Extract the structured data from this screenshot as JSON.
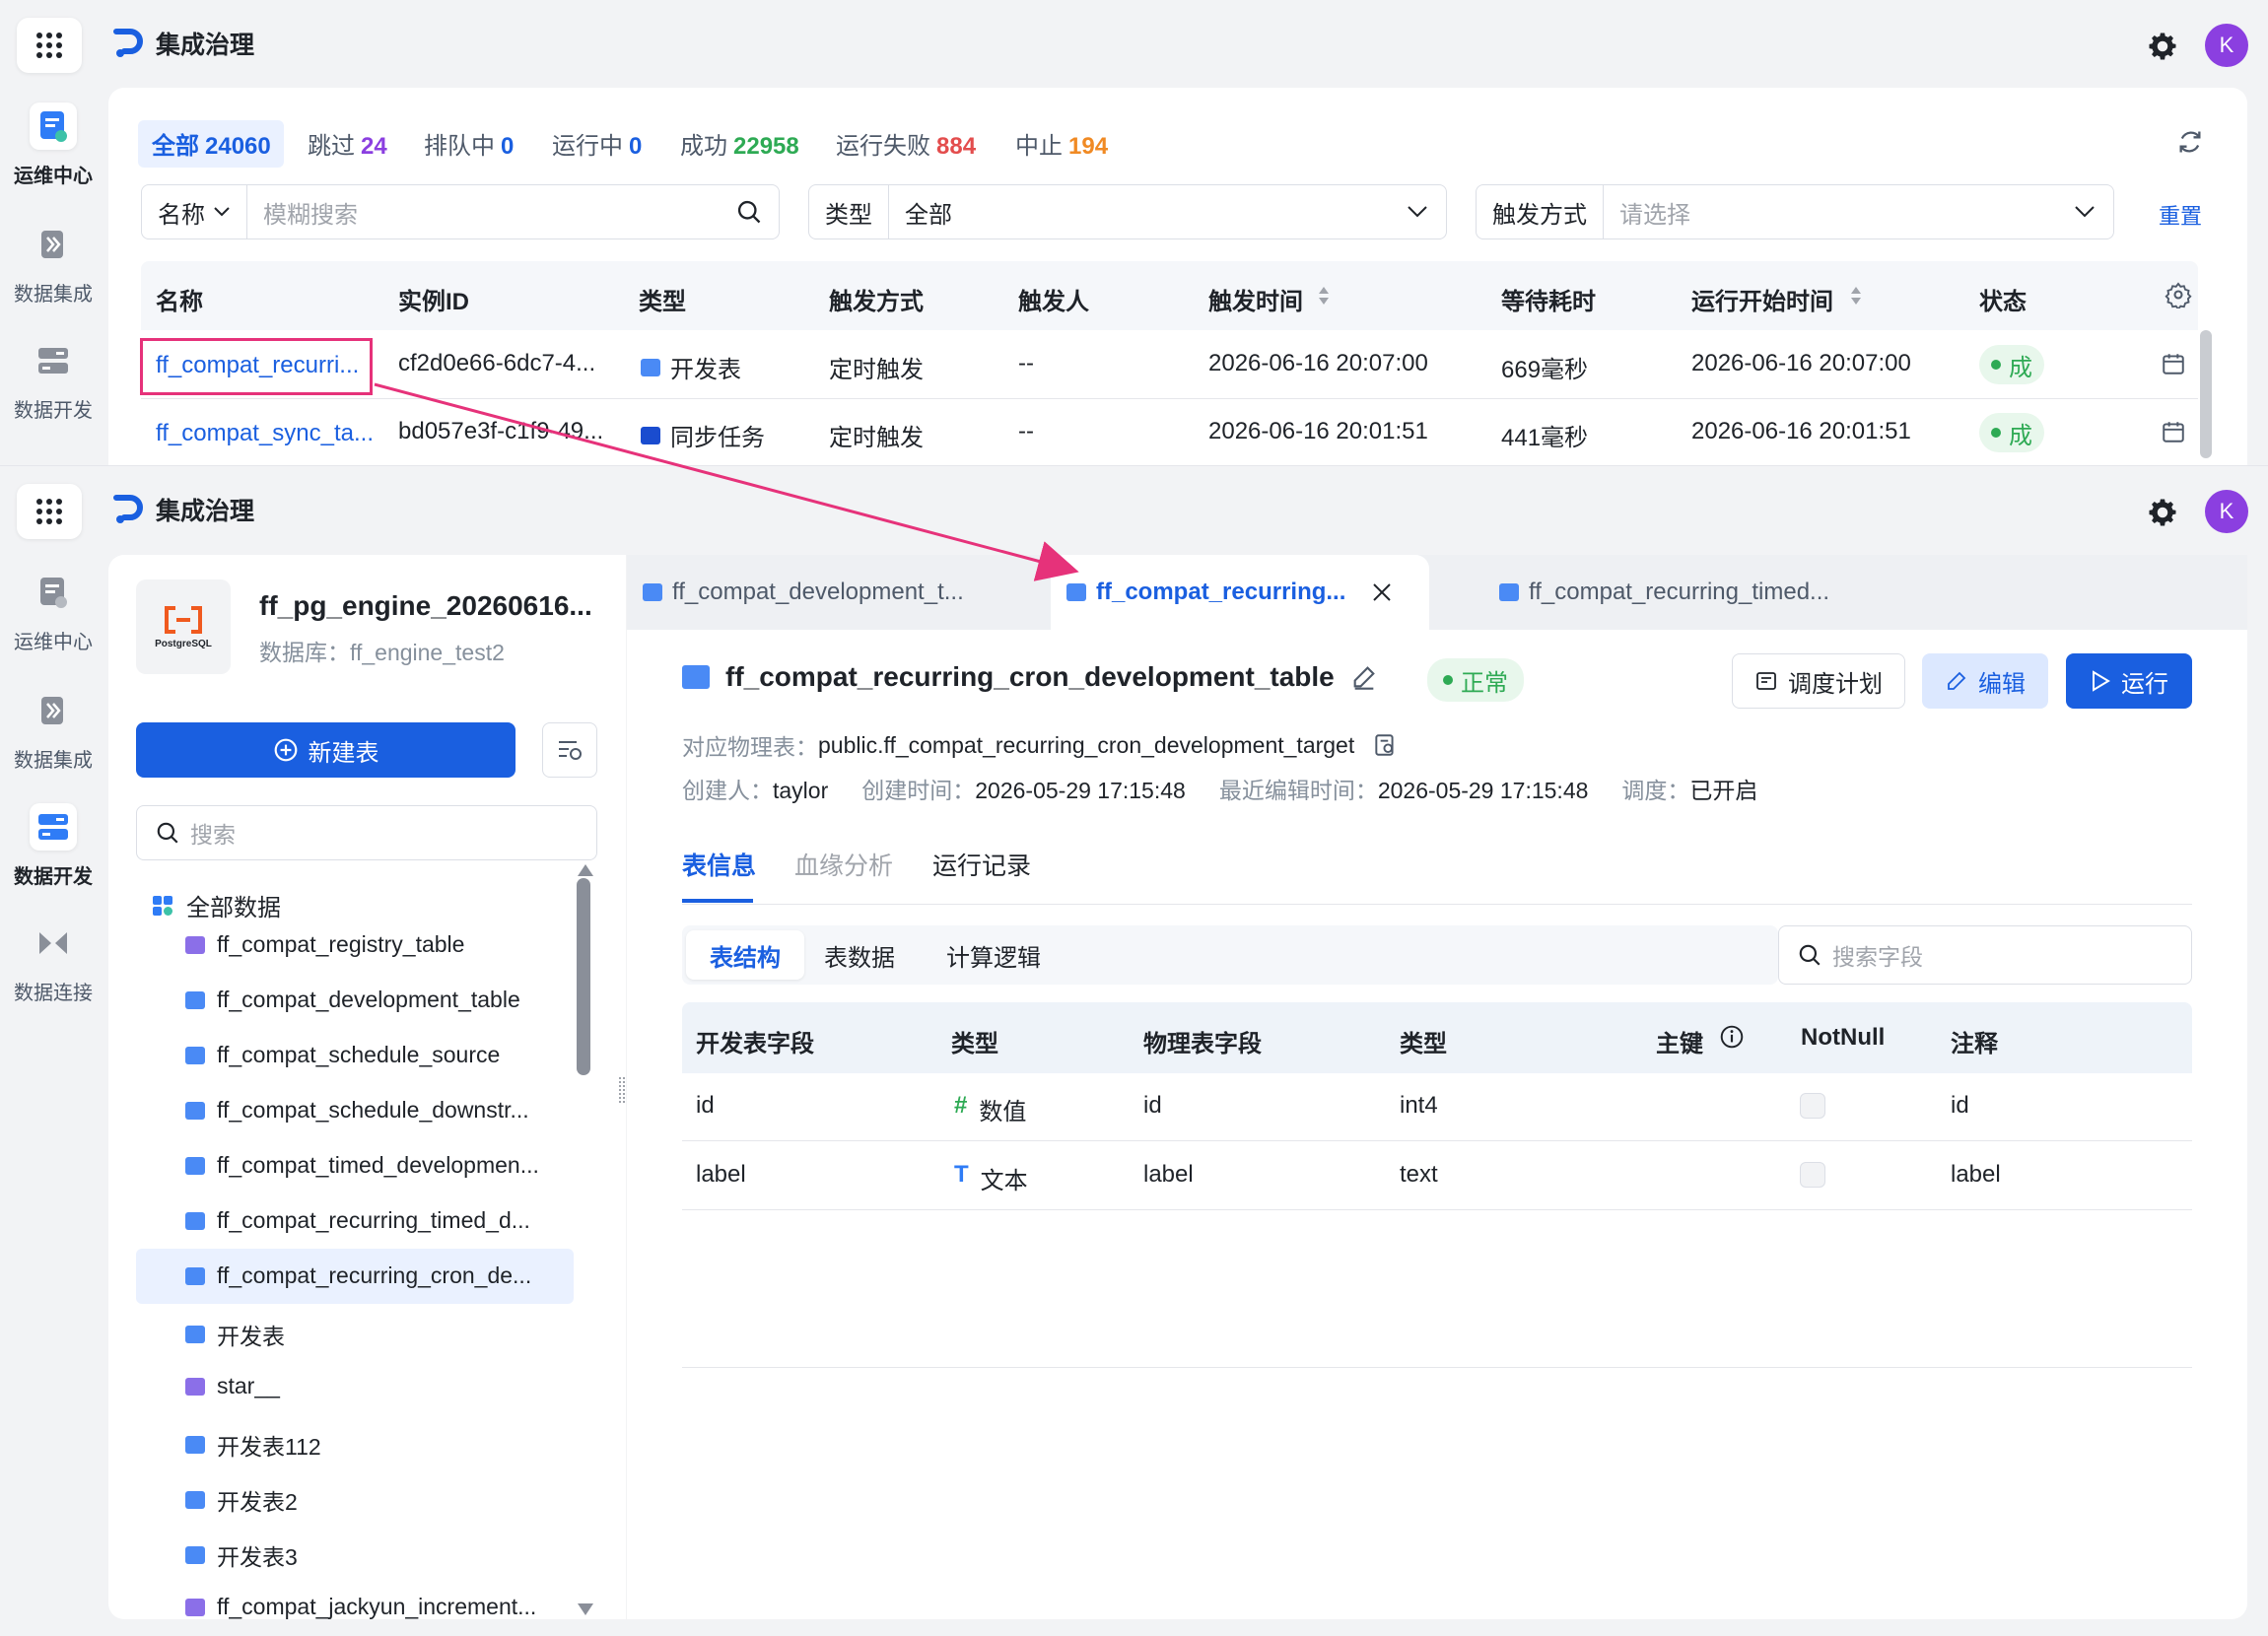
{
  "app": {
    "name": "集成治理",
    "avatar_letter": "K"
  },
  "colors": {
    "primary": "#1a5fe0",
    "success": "#2eaa54",
    "danger": "#e34d4d",
    "warning": "#f08a24",
    "callout": "#e6327a"
  },
  "top": {
    "sidebar": [
      {
        "label": "运维中心",
        "active": true
      },
      {
        "label": "数据集成",
        "active": false
      },
      {
        "label": "数据开发",
        "active": false
      }
    ],
    "stats": [
      {
        "label": "全部",
        "count": "24060"
      },
      {
        "label": "跳过",
        "count": "24"
      },
      {
        "label": "排队中",
        "count": "0"
      },
      {
        "label": "运行中",
        "count": "0"
      },
      {
        "label": "成功",
        "count": "22958"
      },
      {
        "label": "运行失败",
        "count": "884"
      },
      {
        "label": "中止",
        "count": "194"
      }
    ],
    "filters": {
      "name_label": "名称",
      "name_placeholder": "模糊搜索",
      "type_label": "类型",
      "type_value": "全部",
      "trigger_label": "触发方式",
      "trigger_placeholder": "请选择",
      "reset": "重置"
    },
    "table": {
      "headers": [
        "名称",
        "实例ID",
        "类型",
        "触发方式",
        "触发人",
        "触发时间",
        "等待耗时",
        "运行开始时间",
        "状态"
      ],
      "rows": [
        {
          "name": "ff_compat_recurri...",
          "id": "cf2d0e66-6dc7-4...",
          "type": "开发表",
          "trigger": "定时触发",
          "by": "--",
          "time": "2026-06-16 20:07:00",
          "wait": "669毫秒",
          "start": "2026-06-16 20:07:00",
          "status": "成"
        },
        {
          "name": "ff_compat_sync_ta...",
          "id": "bd057e3f-c1f9-49...",
          "type": "同步任务",
          "trigger": "定时触发",
          "by": "--",
          "time": "2026-06-16 20:01:51",
          "wait": "441毫秒",
          "start": "2026-06-16 20:01:51",
          "status": "成"
        }
      ]
    }
  },
  "bottom": {
    "sidebar": [
      {
        "label": "运维中心",
        "active": false
      },
      {
        "label": "数据集成",
        "active": false
      },
      {
        "label": "数据开发",
        "active": true
      },
      {
        "label": "数据连接",
        "active": false
      }
    ],
    "source": {
      "title": "ff_pg_engine_20260616...",
      "db_label": "数据库：",
      "db_name": "ff_engine_test2",
      "logo_text": "PostgreSQL"
    },
    "new_table": "新建表",
    "search_placeholder": "搜索",
    "tree_root": "全部数据",
    "tree": [
      {
        "label": "ff_compat_registry_table",
        "kind": "physical"
      },
      {
        "label": "ff_compat_development_table",
        "kind": "dev"
      },
      {
        "label": "ff_compat_schedule_source",
        "kind": "dev"
      },
      {
        "label": "ff_compat_schedule_downstr...",
        "kind": "dev"
      },
      {
        "label": "ff_compat_timed_developmen...",
        "kind": "dev"
      },
      {
        "label": "ff_compat_recurring_timed_d...",
        "kind": "dev"
      },
      {
        "label": "ff_compat_recurring_cron_de...",
        "kind": "dev",
        "selected": true
      },
      {
        "label": "开发表",
        "kind": "dev"
      },
      {
        "label": "star__",
        "kind": "physical"
      },
      {
        "label": "开发表112",
        "kind": "dev"
      },
      {
        "label": "开发表2",
        "kind": "dev"
      },
      {
        "label": "开发表3",
        "kind": "dev"
      },
      {
        "label": "ff_compat_jackyun_increment...",
        "kind": "physical"
      }
    ],
    "file_tabs": [
      {
        "label": "ff_compat_development_t..."
      },
      {
        "label": "ff_compat_recurring...",
        "active": true
      },
      {
        "label": "ff_compat_recurring_timed..."
      }
    ],
    "detail": {
      "title": "ff_compat_recurring_cron_development_table",
      "status": "正常",
      "btn_schedule": "调度计划",
      "btn_edit": "编辑",
      "btn_run": "运行",
      "physical_label": "对应物理表：",
      "physical_value": "public.ff_compat_recurring_cron_development_target",
      "creator_label": "创建人：",
      "creator": "taylor",
      "created_label": "创建时间：",
      "created": "2026-05-29 17:15:48",
      "edited_label": "最近编辑时间：",
      "edited": "2026-05-29 17:15:48",
      "schedule_label": "调度：",
      "schedule": "已开启",
      "tabs": [
        "表信息",
        "血缘分析",
        "运行记录"
      ],
      "subtabs": [
        "表结构",
        "表数据",
        "计算逻辑"
      ],
      "field_search_placeholder": "搜索字段",
      "headers": [
        "开发表字段",
        "类型",
        "物理表字段",
        "类型",
        "主键",
        "NotNull",
        "注释"
      ],
      "rows": [
        {
          "field": "id",
          "type_icon": "#",
          "type": "数值",
          "phys": "id",
          "ptype": "int4",
          "comment": "id"
        },
        {
          "field": "label",
          "type_icon": "T",
          "type": "文本",
          "phys": "label",
          "ptype": "text",
          "comment": "label"
        }
      ]
    }
  }
}
